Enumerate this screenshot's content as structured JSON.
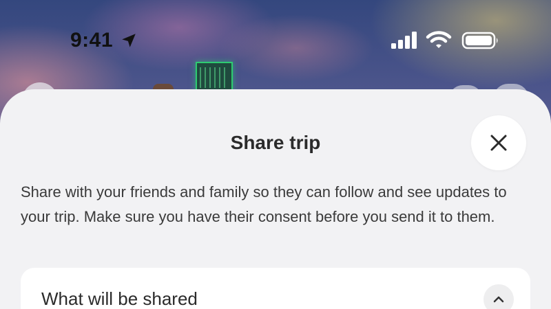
{
  "status_bar": {
    "time": "9:41",
    "icons": [
      "location-arrow-icon",
      "cellular-signal-icon",
      "wifi-icon",
      "battery-icon"
    ]
  },
  "sheet": {
    "title": "Share trip",
    "close_icon": "close-icon",
    "description": "Share with your friends and family so they can follow and see updates to your trip. Make sure you have their consent before you send it to them.",
    "section": {
      "title": "What will be shared",
      "toggle_icon": "chevron-up-icon",
      "expanded": true
    }
  },
  "colors": {
    "sheet_background": "#f2f2f4",
    "card_background": "#ffffff",
    "text_primary": "#2b2b2b"
  }
}
